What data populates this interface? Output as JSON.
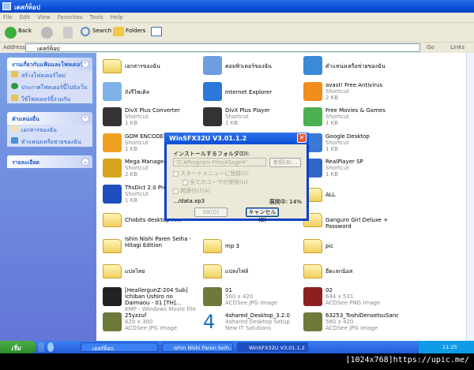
{
  "window": {
    "title": "เดสก์ท็อป"
  },
  "menu": [
    "File",
    "Edit",
    "View",
    "Favorites",
    "Tools",
    "Help"
  ],
  "toolbar": {
    "back": "Back",
    "search": "Search",
    "folders": "Folders"
  },
  "address": {
    "label": "Address",
    "value": "เดสก์ท็อป",
    "go": "Go",
    "links": "Links"
  },
  "sidebar": {
    "panels": [
      {
        "title": "งานเกี่ยวกับแฟ้มและโฟลเดอร์",
        "chevron": "up",
        "items": [
          "สร้างโฟลเดอร์ใหม่",
          "ประกาศโฟลเดอร์นี้ไปยังเว็บ",
          "ใช้โฟลเดอร์นี้ร่วมกัน"
        ]
      },
      {
        "title": "ตำแหน่งอื่น",
        "chevron": "up",
        "items": [
          "เอกสารของฉัน",
          "ตำแหน่งเครือข่ายของฉัน"
        ]
      },
      {
        "title": "รายละเอียด",
        "chevron": "down",
        "items": []
      }
    ]
  },
  "files": [
    {
      "name": "เอกสารของฉัน",
      "type": "folder"
    },
    {
      "name": "คอมพิวเตอร์ของฉัน",
      "type": "computer"
    },
    {
      "name": "ตำแหน่งเครือข่ายของฉัน",
      "type": "network"
    },
    {
      "name": "ถังรีไซเคิล",
      "type": "recycle"
    },
    {
      "name": "Internet Explorer",
      "type": "ie"
    },
    {
      "name": "avast! Free Antivirus",
      "l2": "Shortcut",
      "l3": "2 KB",
      "type": "avast"
    },
    {
      "name": "DivX Plus Converter",
      "l2": "Shortcut",
      "l3": "1 KB",
      "type": "divx"
    },
    {
      "name": "DivX Plus Player",
      "l2": "Shortcut",
      "l3": "1 KB",
      "type": "divx"
    },
    {
      "name": "Free Movies & Games",
      "l2": "Shortcut",
      "l3": "1 KB",
      "type": "gift"
    },
    {
      "name": "GOM ENCODER",
      "l2": "Shortcut",
      "l3": "1 KB",
      "type": "gom"
    },
    null,
    {
      "name": "Google Desktop",
      "l2": "Shortcut",
      "l3": "1 KB",
      "type": "google"
    },
    {
      "name": "Mega Manager",
      "l2": "Shortcut",
      "l3": "2 KB",
      "type": "mega"
    },
    null,
    {
      "name": "RealPlayer SP",
      "l2": "Shortcut",
      "l3": "1 KB",
      "type": "real"
    },
    {
      "name": "ThsDict 2.0 Progra...",
      "l2": "Shortcut",
      "l3": "1 KB",
      "type": "dict"
    },
    null,
    {
      "name": "ALL",
      "type": "folder"
    },
    {
      "name": "Chobits desktop m...",
      "type": "folder"
    },
    null,
    {
      "name": "Ganguro Girl Deluxe + Password",
      "type": "folder"
    },
    {
      "name": "Ishin Nishi Paren Seiha - Hitagi Edition",
      "type": "folder"
    },
    {
      "name": "mp 3",
      "type": "folder"
    },
    {
      "name": "pic",
      "type": "folder"
    },
    {
      "name": "แปลไทย",
      "type": "folder"
    },
    {
      "name": "แปลงไฟล์",
      "type": "folder"
    },
    {
      "name": "อีตะลกนิอส",
      "type": "folder"
    },
    {
      "name": "[HeallergunZ-204 Sub] Ichiban Ushiro no Daimaou - 01 [TH]...",
      "l3": "KMP - Windows Movie File",
      "type": "avi"
    },
    {
      "name": "01",
      "l2": "560 x 420",
      "l3": "ACDSee JPG Image",
      "type": "jpg"
    },
    {
      "name": "02",
      "l2": "644 x 531",
      "l3": "ACDSee PNG Image",
      "type": "png"
    },
    {
      "name": "25yzzuf",
      "l2": "620 x 300",
      "l3": "ACDSee JPG Image",
      "type": "jpg"
    },
    {
      "name": "4shared_Desktop_3.2.0",
      "l2": "4shared Desktop Setup",
      "l3": "New IT Solutions",
      "type": "4shared"
    },
    {
      "name": "63253_ToshiDensetsuSandos...",
      "l2": "560 x 420",
      "l3": "ACDSee JPG Image",
      "type": "jpg"
    }
  ],
  "dialog": {
    "title": "WinSFX32U V3.01.1.2",
    "folder_label": "インストールするフォルダ(D):",
    "folder_value": "\"C:¥Program Files¥Sage¥\"",
    "browse": "参照(B)...",
    "startmenu": "スタートメニューに登録(S)",
    "allusers": "全てのユーザが使用(U)",
    "assoc": "関連付け(A)",
    "file": ".../data.xp3",
    "progress": "展開中: 14%",
    "ok": "OK(O)",
    "cancel": "キャンセル(C)"
  },
  "taskbar": {
    "start": "เริ่ม",
    "buttons": [
      "เดสก์ท็อป",
      "Ishin Nishi Paren Seih...",
      "WinSFX32U V3.01.1.2"
    ],
    "lang": "EN",
    "clock": "11:25"
  },
  "watermark": "[1024x768]https://upic.me/",
  "colors": {
    "titlebar": "#0a4fd6",
    "sidebar": "#6f8ee0",
    "taskbar": "#2459d8"
  }
}
